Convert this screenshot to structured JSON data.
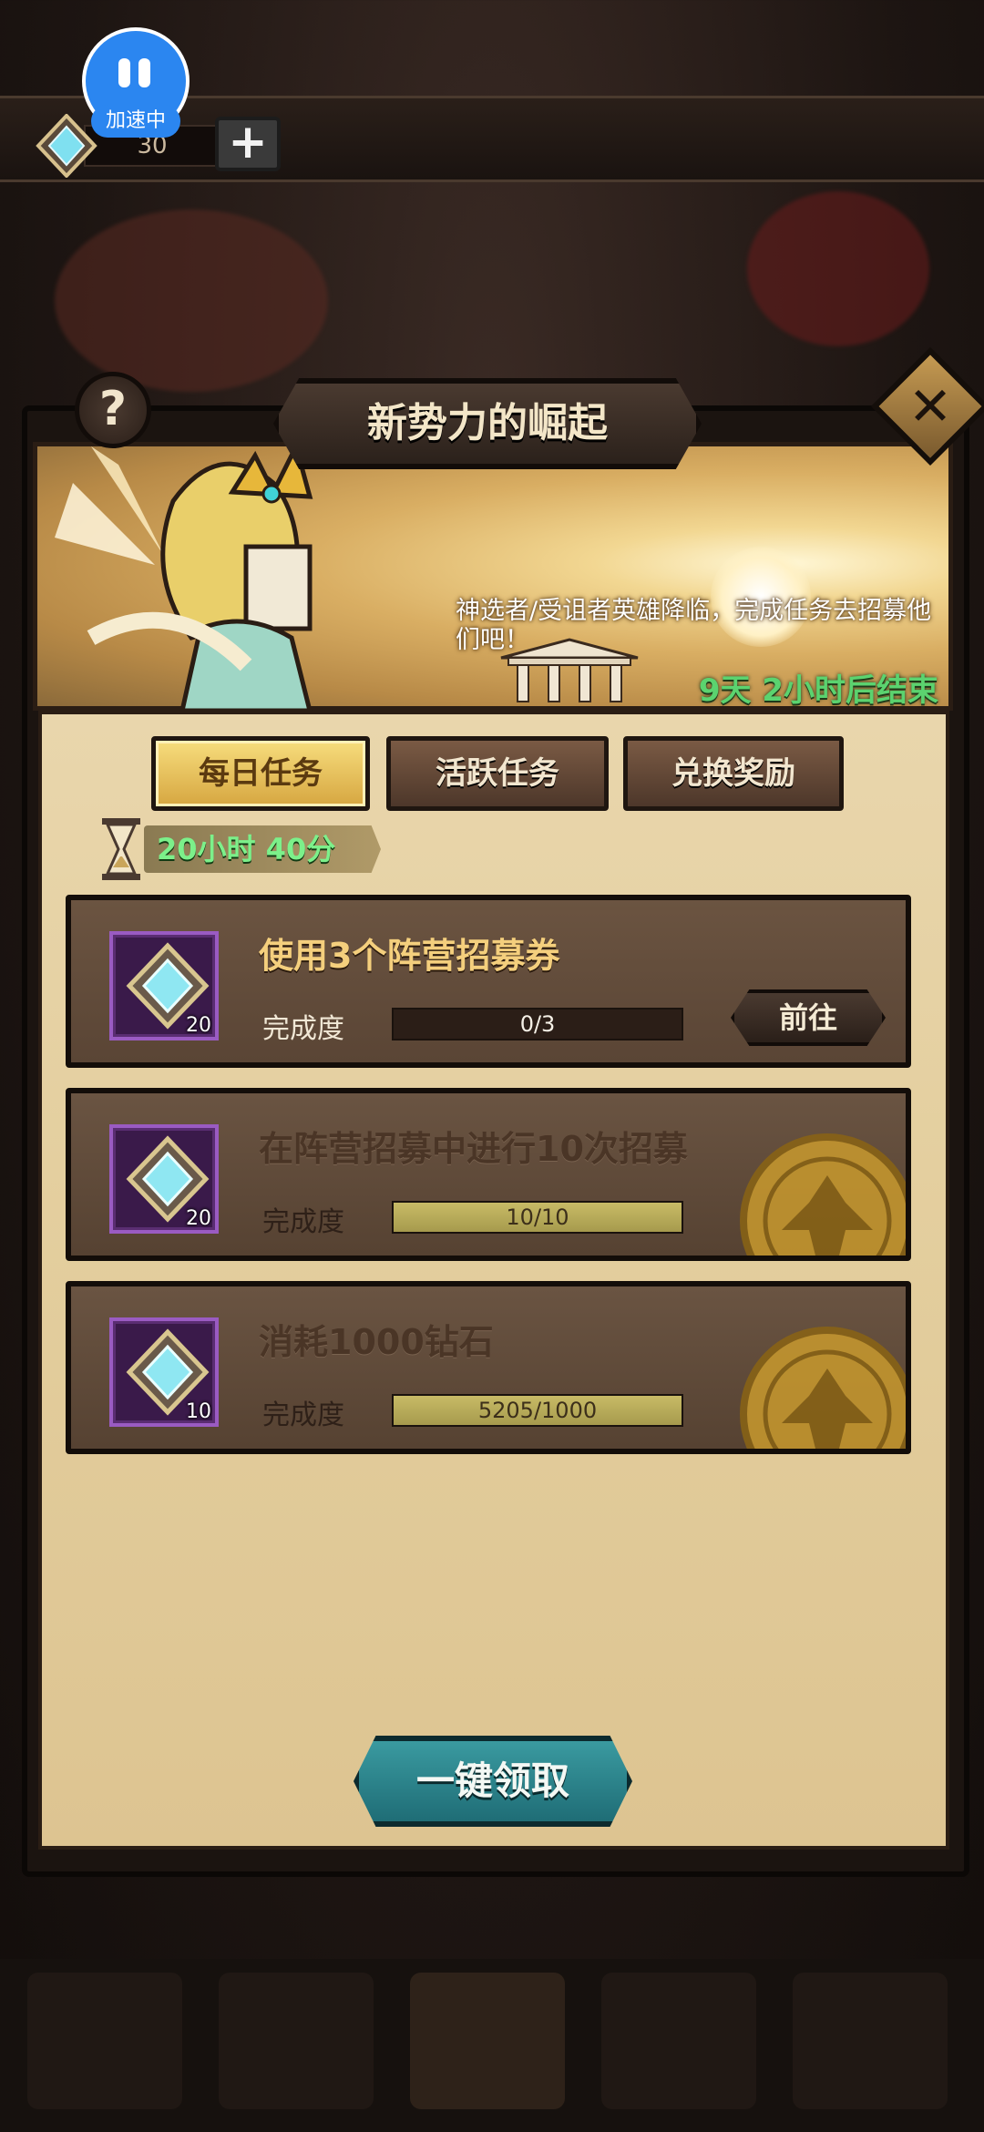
{
  "topbar": {
    "gem_count": "30",
    "add_label": "+",
    "speed_badge": "加速中"
  },
  "panel": {
    "title": "新势力的崛起",
    "help_label": "?",
    "close_label": "✕",
    "banner_description": "神选者/受诅者英雄降临，完成任务去招募他们吧！",
    "banner_timer": "9天 2小时后结束"
  },
  "tabs": [
    {
      "label": "每日任务",
      "active": true
    },
    {
      "label": "活跃任务",
      "active": false
    },
    {
      "label": "兑换奖励",
      "active": false
    }
  ],
  "countdown": "20小时 40分",
  "tasks": [
    {
      "title": "使用3个阵营招募券",
      "reward_count": "20",
      "progress_label": "完成度",
      "progress_text": "0/3",
      "progress_fraction": 0,
      "button_label": "前往",
      "completed": false
    },
    {
      "title": "在阵营招募中进行10次招募",
      "reward_count": "20",
      "progress_label": "完成度",
      "progress_text": "10/10",
      "progress_fraction": 1,
      "completed": true
    },
    {
      "title": "消耗1000钻石",
      "reward_count": "10",
      "progress_label": "完成度",
      "progress_text": "5205/1000",
      "progress_fraction": 1,
      "completed": true
    }
  ],
  "claim_all_label": "一键领取",
  "icons": [
    "gem-icon",
    "plus-icon",
    "pause-icon",
    "help-icon",
    "close-icon",
    "hourglass-icon",
    "recruit-ticket-icon",
    "completed-seal-icon"
  ],
  "colors": {
    "accent_gold": "#f4cf7d",
    "timer_green": "#5bd36f",
    "claim_teal": "#2a8890",
    "speed_blue": "#2b86f0"
  }
}
